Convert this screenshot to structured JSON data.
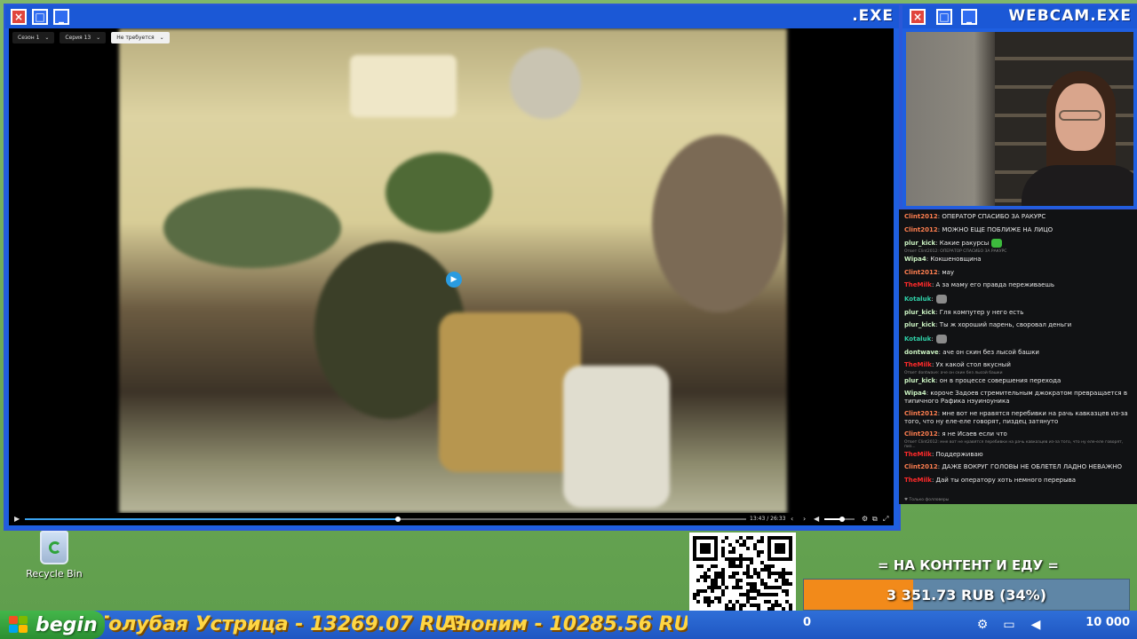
{
  "player_window": {
    "title": ".EXE",
    "buttons": {
      "close": "×",
      "maximize": "□",
      "minimize": "_"
    },
    "selects": [
      {
        "label": "Сезон 1"
      },
      {
        "label": "Серия 13"
      },
      {
        "label": "Не требуется"
      }
    ],
    "current_time": "13:43",
    "separator": "/",
    "duration": "26:33",
    "progress": 0.517,
    "volume": 0.6
  },
  "webcam_window": {
    "title": "WEBCAM.EXE"
  },
  "chat": {
    "messages": [
      {
        "user": "Clint2012",
        "color": "#ff7f50",
        "text": ": ОПЕРАТОР СПАСИБО ЗА РАКУРС"
      },
      {
        "user": "Clint2012",
        "color": "#ff7f50",
        "text": ": МОЖНО ЕЩЕ ПОБЛИЖЕ НА ЛИЦО"
      },
      {
        "user": "plur_kick",
        "color": "#c9f0c0",
        "text": ": Какие ракурсы",
        "emote": "#3dbb3d"
      },
      {
        "reply": "Ответ Clint2012: ОПЕРАТОР СПАСИБО ЗА РАКУРС"
      },
      {
        "user": "Wipa4",
        "color": "#c9f0c0",
        "text": ": Кокшеновщина"
      },
      {
        "user": "Clint2012",
        "color": "#ff7f50",
        "text": ": мау"
      },
      {
        "user": "TheMilk",
        "color": "#ff2a2a",
        "text": ": А за маму его правда переживаешь"
      },
      {
        "user": "Kotaluk",
        "color": "#2fd0a8",
        "text": ":",
        "emote": "#8b8b8b"
      },
      {
        "user": "plur_kick",
        "color": "#c9f0c0",
        "text": ": Гля компутер у него есть"
      },
      {
        "user": "plur_kick",
        "color": "#c9f0c0",
        "text": ": Ты ж хороший парень, своровал деньги"
      },
      {
        "user": "Kotaluk",
        "color": "#2fd0a8",
        "text": ":",
        "emote": "#8b8b8b"
      },
      {
        "user": "dontwave",
        "color": "#c9f0c0",
        "text": ": аче он скин без лысой башки"
      },
      {
        "user": "TheMilk",
        "color": "#ff2a2a",
        "text": ": Ух какой стол вкусный"
      },
      {
        "reply": "Ответ dontwave: аче он скин без лысой башки"
      },
      {
        "user": "plur_kick",
        "color": "#c9f0c0",
        "text": ": он в процессе совершения перехода"
      },
      {
        "user": "Wipa4",
        "color": "#c9f0c0",
        "text": ": короче Задоев стремительным джократом превращается в типичного Рафика нэуиноуника"
      },
      {
        "user": "Clint2012",
        "color": "#ff7f50",
        "text": ": мне вот не нравятся перебивки на рачь кавказцев из-за того, что ну еле-еле говорят, пиздец затянуто"
      },
      {
        "user": "Clint2012",
        "color": "#ff7f50",
        "text": ": я не Исаев если что"
      },
      {
        "reply": "Ответ Clint2012: мне вот не нравятся перебивки на рачь кавказцев из-за того, что ну еле-еле говорят, пиз..."
      },
      {
        "user": "TheMilk",
        "color": "#ff2a2a",
        "text": ": Поддерживаю"
      },
      {
        "user": "Clint2012",
        "color": "#ff7f50",
        "text": ": ДАЖЕ ВОКРУГ ГОЛОВЫ НЕ ОБЛЕТЕЛ ЛАДНО НЕВАЖНО"
      },
      {
        "user": "TheMilk",
        "color": "#ff2a2a",
        "text": ": Дай ты оператору хоть немного перерыва"
      }
    ],
    "footer": "♥ Только фолловеры"
  },
  "desktop": {
    "recycle_bin_label": "Recycle Bin"
  },
  "goal": {
    "title": "= НА КОНТЕНТ И ЕДУ =",
    "amount_label": "3 351.73 RUB (34%)",
    "fraction": 0.335
  },
  "taskbar": {
    "start_label": "begin",
    "ticker_1": "Голубая Устрица - 13269.07 RUB",
    "ticker_2": "Аноним - 10285.56 RUB",
    "left_value": "0",
    "right_value": "10 000",
    "tray_icons": [
      "steam-icon",
      "monitor-icon",
      "volume-icon"
    ]
  }
}
